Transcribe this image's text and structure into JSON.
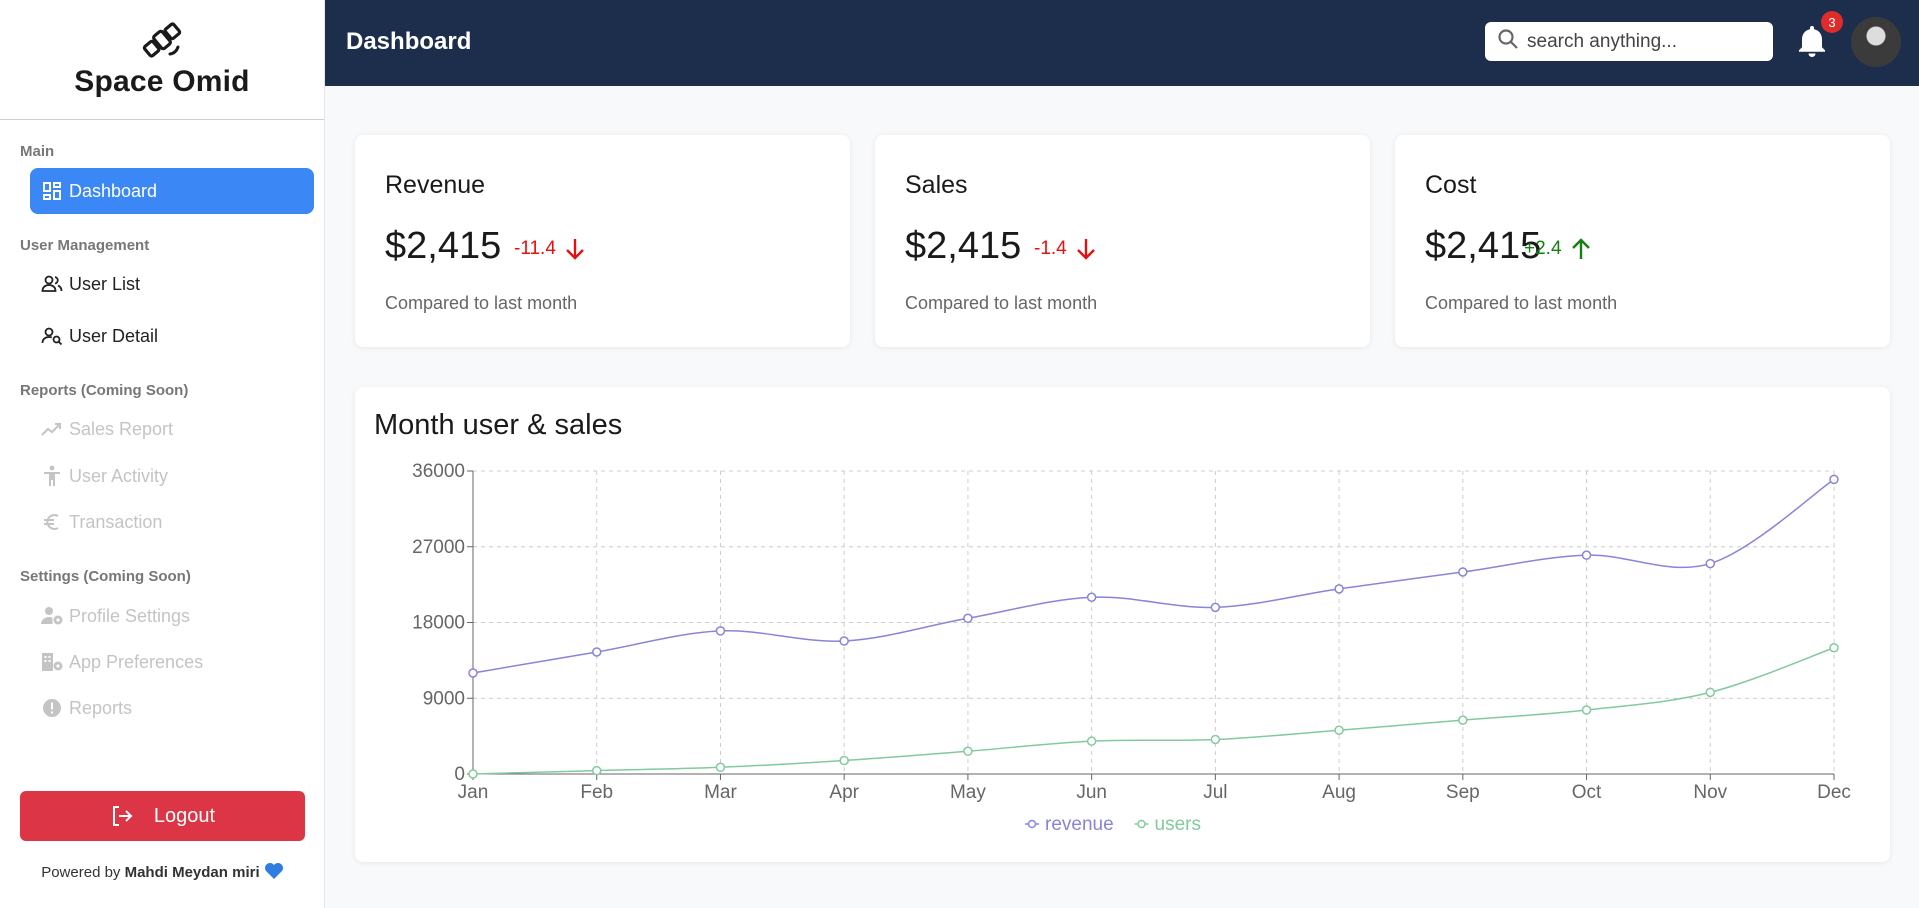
{
  "brand": {
    "name": "Space Omid",
    "icon": "satellite-icon"
  },
  "sidebar": {
    "sections": [
      {
        "title": "Main"
      },
      {
        "title": "User Management"
      },
      {
        "title": "Reports (Coming Soon)"
      },
      {
        "title": "Settings (Coming Soon)"
      }
    ],
    "items": [
      {
        "label": "Dashboard",
        "icon": "dashboard-icon",
        "active": true
      },
      {
        "label": "User List",
        "icon": "users-icon"
      },
      {
        "label": "User Detail",
        "icon": "user-search-icon"
      },
      {
        "label": "Sales Report",
        "icon": "trending-up-icon",
        "disabled": true
      },
      {
        "label": "User Activity",
        "icon": "accessibility-icon",
        "disabled": true
      },
      {
        "label": "Transaction",
        "icon": "euro-icon",
        "disabled": true
      },
      {
        "label": "Profile Settings",
        "icon": "user-gear-icon",
        "disabled": true
      },
      {
        "label": "App Preferences",
        "icon": "building-gear-icon",
        "disabled": true
      },
      {
        "label": "Reports",
        "icon": "alert-circle-icon",
        "disabled": true
      }
    ],
    "logout_label": "Logout",
    "powered_prefix": "Powered by",
    "powered_name": "Mahdi Meydan miri"
  },
  "header": {
    "title": "Dashboard",
    "search_placeholder": "search anything...",
    "notification_count": "3"
  },
  "stats": [
    {
      "title": "Revenue",
      "value": "$2,415",
      "change": "-11.4",
      "direction": "down",
      "subtitle": "Compared to last month"
    },
    {
      "title": "Sales",
      "value": "$2,415",
      "change": "-1.4",
      "direction": "down",
      "subtitle": "Compared to last month"
    },
    {
      "title": "Cost",
      "value": "$2,415",
      "change": "+2.4",
      "direction": "up",
      "subtitle": "Compared to last month"
    }
  ],
  "colors": {
    "accent": "#3b87f5",
    "header": "#1c2e4b",
    "danger": "#dc3545",
    "revenue": "#8884d8",
    "users": "#82ca9d",
    "negative": "#e31010",
    "positive": "#128012"
  },
  "chart_data": {
    "type": "line",
    "title": "Month user & sales",
    "categories": [
      "Jan",
      "Feb",
      "Mar",
      "Apr",
      "May",
      "Jun",
      "Jul",
      "Aug",
      "Sep",
      "Oct",
      "Nov",
      "Dec"
    ],
    "series": [
      {
        "name": "revenue",
        "color": "#8884d8",
        "values": [
          12000,
          14500,
          17000,
          15800,
          18500,
          21000,
          19800,
          22000,
          24000,
          26000,
          25000,
          35000
        ]
      },
      {
        "name": "users",
        "color": "#82ca9d",
        "values": [
          0,
          400,
          800,
          1600,
          2700,
          3900,
          4100,
          5200,
          6400,
          7600,
          9700,
          15000
        ]
      }
    ],
    "ylim": [
      0,
      36000
    ],
    "yticks": [
      "0",
      "9000",
      "18000",
      "27000",
      "36000"
    ],
    "grid": true,
    "legend": "bottom-center"
  }
}
